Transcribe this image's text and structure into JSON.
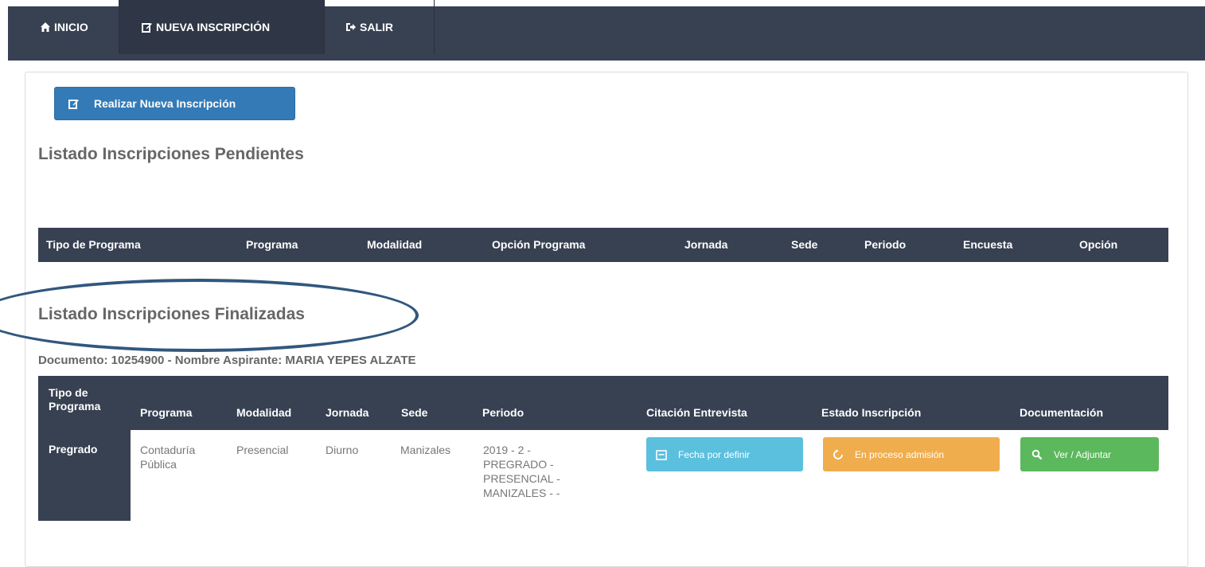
{
  "nav": {
    "items": [
      {
        "label": "INICIO",
        "icon": "home-icon"
      },
      {
        "label": "NUEVA INSCRIPCIÓN",
        "icon": "edit-icon"
      },
      {
        "label": "SALIR",
        "icon": "sign-out-icon"
      }
    ]
  },
  "new_button": {
    "label": "Realizar Nueva Inscripción",
    "icon": "edit-icon"
  },
  "pending": {
    "title": "Listado Inscripciones Pendientes",
    "headers": [
      "Tipo de Programa",
      "Programa",
      "Modalidad",
      "Opción Programa",
      "Jornada",
      "Sede",
      "Periodo",
      "Encuesta",
      "Opción"
    ]
  },
  "finished": {
    "title": "Listado Inscripciones Finalizadas",
    "doc_line": "Documento: 10254900 - Nombre Aspirante: MARIA YEPES ALZATE",
    "headers": [
      "Tipo de Programa",
      "Programa",
      "Modalidad",
      "Jornada",
      "Sede",
      "Periodo",
      "Citación Entrevista",
      "Estado Inscripción",
      "Documentación"
    ],
    "header_tipo_line1": "Tipo de",
    "header_tipo_line2": "Programa",
    "row": {
      "tipo": "Pregrado",
      "programa_l1": "Contaduría",
      "programa_l2": "Pública",
      "modalidad": "Presencial",
      "jornada": "Diurno",
      "sede": "Manizales",
      "periodo_lines": [
        "2019 - 2 -",
        "PREGRADO -",
        "PRESENCIAL -",
        "MANIZALES - -"
      ],
      "citacion": "Fecha por definir",
      "estado": "En proceso admisión",
      "documentacion": "Ver / Adjuntar"
    }
  },
  "colors": {
    "nav_bg": "#384152",
    "primary": "#337ab7",
    "info": "#5bc0de",
    "warning": "#f0ad4e",
    "success": "#5cb85c",
    "ellipse": "#31577e"
  }
}
